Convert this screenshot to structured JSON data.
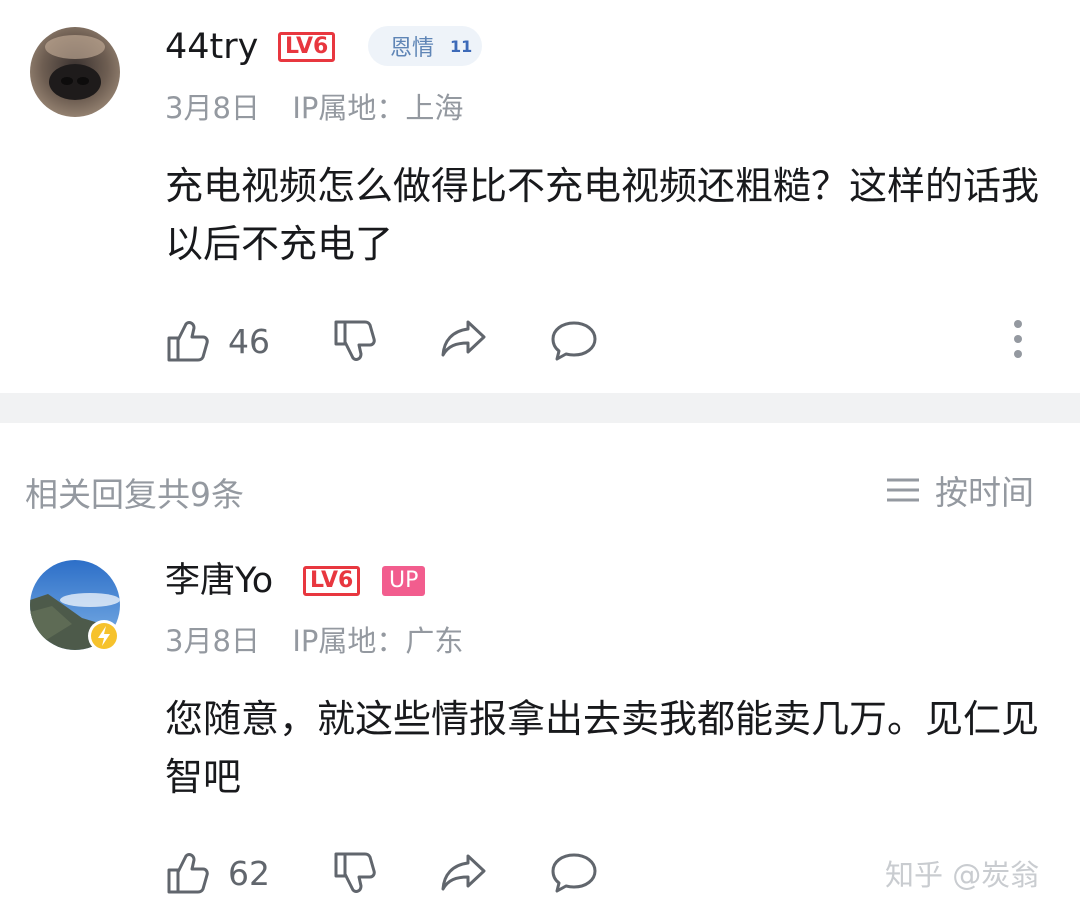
{
  "comment1": {
    "username": "44try",
    "level_badge": "LV6",
    "fan_badge": {
      "label": "恩情",
      "level": "11"
    },
    "date": "3月8日",
    "ip_location": "IP属地：上海",
    "content": "充电视频怎么做得比不充电视频还粗糙？这样的话我以后不充电了",
    "like_count": "46"
  },
  "replies_header": {
    "title": "相关回复共9条",
    "sort_label": "按时间"
  },
  "comment2": {
    "username": "李唐Yo",
    "level_badge": "LV6",
    "up_badge": "UP",
    "date": "3月8日",
    "ip_location": "IP属地：广东",
    "content": "您随意，就这些情报拿出去卖我都能卖几万。见仁见智吧",
    "like_count": "62"
  },
  "watermark": "知乎 @炭翁",
  "icons": {
    "like": "thumbs-up-icon",
    "dislike": "thumbs-down-icon",
    "share": "share-icon",
    "reply": "reply-bubble-icon",
    "more": "more-vertical-icon",
    "sort": "sort-lines-icon",
    "charge": "lightning-icon"
  },
  "colors": {
    "level_red": "#e8373f",
    "up_pink": "#f25d8e",
    "fan_blue": "#5f85b6",
    "charge_yellow": "#f6c22c",
    "meta_gray": "#9499a0"
  }
}
